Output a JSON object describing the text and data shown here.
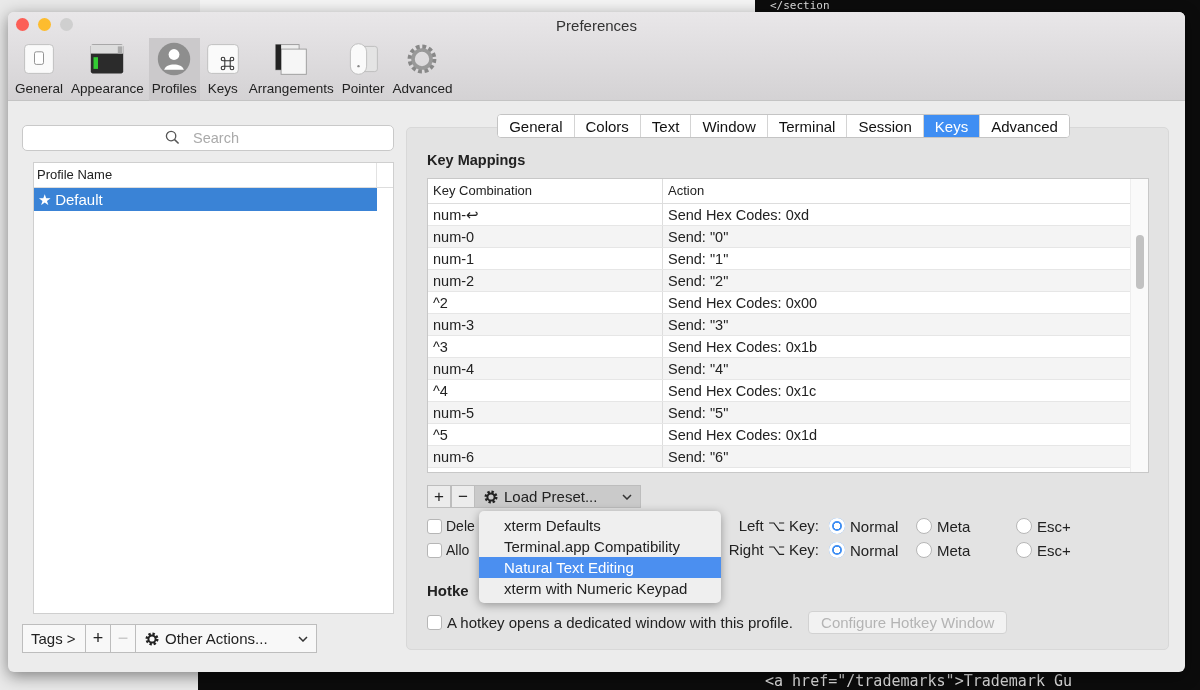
{
  "background": {
    "terminal_lines": [
      "</section",
      "<a href=\"/trademarks\">Trademark Gu"
    ]
  },
  "window": {
    "title": "Preferences"
  },
  "toolbar": [
    {
      "label": "General",
      "kind": "general",
      "selected": false
    },
    {
      "label": "Appearance",
      "kind": "appearance",
      "selected": false
    },
    {
      "label": "Profiles",
      "kind": "profiles",
      "selected": true
    },
    {
      "label": "Keys",
      "kind": "keys",
      "selected": false
    },
    {
      "label": "Arrangements",
      "kind": "arrangements",
      "selected": false
    },
    {
      "label": "Pointer",
      "kind": "pointer",
      "selected": false
    },
    {
      "label": "Advanced",
      "kind": "advanced",
      "selected": false
    }
  ],
  "sidebar": {
    "search": {
      "placeholder": "Search"
    },
    "column": "Profile Name",
    "profiles": [
      {
        "label": "★ Default",
        "selected": true
      }
    ],
    "tags_button": "Tags >",
    "add": "+",
    "remove": {
      "label": "−",
      "disabled": true
    },
    "other_actions": "Other Actions..."
  },
  "tabs": [
    {
      "label": "General",
      "selected": false
    },
    {
      "label": "Colors",
      "selected": false
    },
    {
      "label": "Text",
      "selected": false
    },
    {
      "label": "Window",
      "selected": false
    },
    {
      "label": "Terminal",
      "selected": false
    },
    {
      "label": "Session",
      "selected": false
    },
    {
      "label": "Keys",
      "selected": true
    },
    {
      "label": "Advanced",
      "selected": false
    }
  ],
  "key_mappings": {
    "title": "Key Mappings",
    "columns": [
      "Key Combination",
      "Action"
    ],
    "rows": [
      {
        "key": "num-↩",
        "action": "Send Hex Codes: 0xd"
      },
      {
        "key": "num-0",
        "action": "Send: \"0\""
      },
      {
        "key": "num-1",
        "action": "Send: \"1\""
      },
      {
        "key": "num-2",
        "action": "Send: \"2\""
      },
      {
        "key": "^2",
        "action": "Send Hex Codes: 0x00"
      },
      {
        "key": "num-3",
        "action": "Send: \"3\""
      },
      {
        "key": "^3",
        "action": "Send Hex Codes: 0x1b"
      },
      {
        "key": "num-4",
        "action": "Send: \"4\""
      },
      {
        "key": "^4",
        "action": "Send Hex Codes: 0x1c"
      },
      {
        "key": "num-5",
        "action": "Send: \"5\""
      },
      {
        "key": "^5",
        "action": "Send Hex Codes: 0x1d"
      },
      {
        "key": "num-6",
        "action": "Send: \"6\""
      }
    ]
  },
  "preset_bar": {
    "add": "+",
    "remove": "−",
    "preset": "Load Preset..."
  },
  "preset_menu": [
    {
      "label": "xterm Defaults",
      "selected": false
    },
    {
      "label": "Terminal.app Compatibility",
      "selected": false
    },
    {
      "label": "Natural Text Editing",
      "selected": true
    },
    {
      "label": "xterm with Numeric Keypad",
      "selected": false
    }
  ],
  "checkboxes": [
    {
      "label": "Dele",
      "checked": false
    },
    {
      "label": "Allo",
      "checked": false
    }
  ],
  "option_keys": [
    {
      "label": "Left ⌥ Key:",
      "options": [
        {
          "label": "Normal",
          "selected": true
        },
        {
          "label": "Meta",
          "selected": false
        },
        {
          "label": "Esc+",
          "selected": false
        }
      ]
    },
    {
      "label": "Right ⌥ Key:",
      "options": [
        {
          "label": "Normal",
          "selected": true
        },
        {
          "label": "Meta",
          "selected": false
        },
        {
          "label": "Esc+",
          "selected": false
        }
      ]
    }
  ],
  "hotkey": {
    "title": "Hotke",
    "checkbox": {
      "label": "A hotkey opens a dedicated window with this profile.",
      "checked": false
    },
    "button": {
      "label": "Configure Hotkey Window",
      "disabled": true
    }
  }
}
